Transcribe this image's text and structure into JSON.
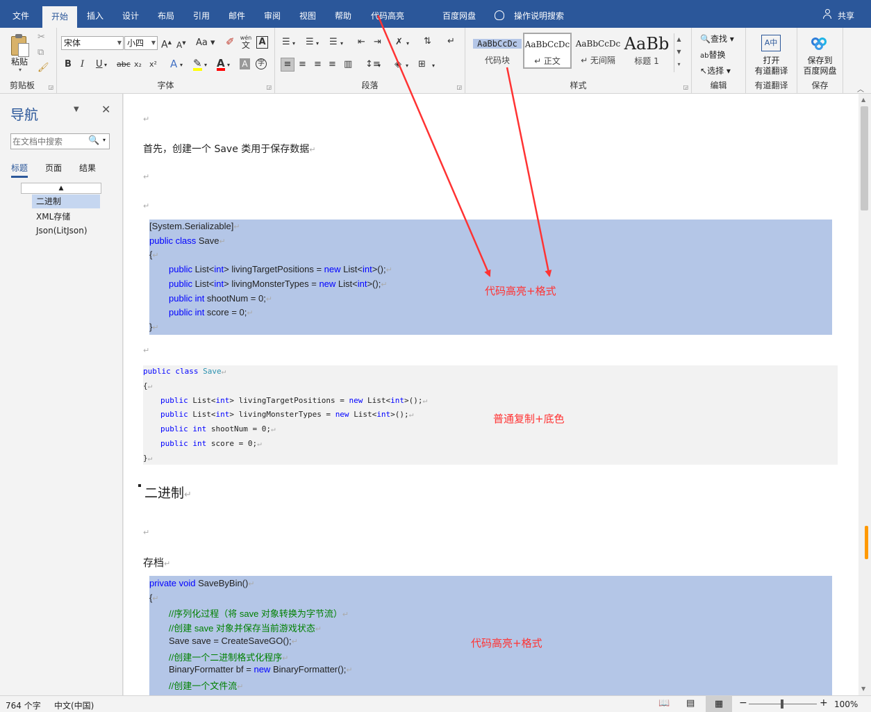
{
  "tabs": [
    "文件",
    "开始",
    "插入",
    "设计",
    "布局",
    "引用",
    "邮件",
    "审阅",
    "视图",
    "帮助",
    "代码高亮",
    "百度网盘"
  ],
  "tell_me": "操作说明搜索",
  "share": "共享",
  "ribbon": {
    "clipboard": {
      "paste": "粘贴",
      "label": "剪贴板"
    },
    "font": {
      "name": "宋体",
      "size": "小四",
      "label": "字体",
      "wen": "wén",
      "wen_char": "文",
      "grow": "A",
      "shrink": "A",
      "case": "Aa",
      "bold": "B",
      "italic": "I",
      "underline": "U",
      "strike": "abc",
      "sub": "x₂",
      "sup": "x²"
    },
    "paragraph": {
      "label": "段落"
    },
    "styles": {
      "label": "样式",
      "items": [
        {
          "sample": "AaBbCcDc",
          "name": "代码块"
        },
        {
          "sample": "AaBbCcDc",
          "name": "↵ 正文"
        },
        {
          "sample": "AaBbCcDc",
          "name": "↵ 无间隔"
        },
        {
          "sample": "AaBb",
          "name": "标题 1"
        }
      ]
    },
    "editing": {
      "find": "查找",
      "replace": "替换",
      "select": "选择",
      "label": "编辑"
    },
    "youdao": {
      "btn1": "打开",
      "btn2": "有道翻译",
      "label": "有道翻译"
    },
    "save": {
      "btn1": "保存到",
      "btn2": "百度网盘",
      "label": "保存"
    }
  },
  "nav": {
    "title": "导航",
    "search_placeholder": "在文档中搜索",
    "tabs": [
      "标题",
      "页面",
      "结果"
    ],
    "items": [
      "二进制",
      "XML存储",
      "Json(LitJson)"
    ]
  },
  "doc": {
    "p1": "首先，创建一个 Save 类用于保存数据",
    "heading": "二进制",
    "p2": "存档",
    "annot1": "代码高亮+格式",
    "annot2": "普通复制+底色",
    "annot3": "代码高亮+格式",
    "ret": "↵"
  },
  "code1": [
    {
      "indent": 0,
      "parts": [
        {
          "t": "[System.Serializable]",
          "c": ""
        }
      ]
    },
    {
      "indent": 0,
      "parts": [
        {
          "t": "public class ",
          "c": "kw"
        },
        {
          "t": "Save",
          "c": ""
        }
      ]
    },
    {
      "indent": 0,
      "parts": [
        {
          "t": "{",
          "c": ""
        }
      ]
    },
    {
      "indent": 1,
      "parts": [
        {
          "t": "public ",
          "c": "kw"
        },
        {
          "t": "List<",
          "c": ""
        },
        {
          "t": "int",
          "c": "kw"
        },
        {
          "t": "> livingTargetPositions = ",
          "c": ""
        },
        {
          "t": "new ",
          "c": "kw"
        },
        {
          "t": "List<",
          "c": ""
        },
        {
          "t": "int",
          "c": "kw"
        },
        {
          "t": ">();",
          "c": ""
        }
      ]
    },
    {
      "indent": 1,
      "parts": [
        {
          "t": "public ",
          "c": "kw"
        },
        {
          "t": "List<",
          "c": ""
        },
        {
          "t": "int",
          "c": "kw"
        },
        {
          "t": "> livingMonsterTypes = ",
          "c": ""
        },
        {
          "t": "new ",
          "c": "kw"
        },
        {
          "t": "List<",
          "c": ""
        },
        {
          "t": "int",
          "c": "kw"
        },
        {
          "t": ">();",
          "c": ""
        }
      ]
    },
    {
      "indent": 1,
      "parts": [
        {
          "t": "public int ",
          "c": "kw"
        },
        {
          "t": "shootNum = 0;",
          "c": ""
        }
      ]
    },
    {
      "indent": 1,
      "parts": [
        {
          "t": "public int ",
          "c": "kw"
        },
        {
          "t": "score = 0;",
          "c": ""
        }
      ]
    },
    {
      "indent": 0,
      "parts": [
        {
          "t": "}",
          "c": ""
        }
      ]
    }
  ],
  "code2": [
    {
      "indent": 0,
      "parts": [
        {
          "t": "public class ",
          "c": "pk"
        },
        {
          "t": "Save",
          "c": "ptype"
        }
      ]
    },
    {
      "indent": 0,
      "parts": [
        {
          "t": "{",
          "c": ""
        }
      ]
    },
    {
      "indent": 1,
      "parts": [
        {
          "t": "public ",
          "c": "pk"
        },
        {
          "t": "List<",
          "c": ""
        },
        {
          "t": "int",
          "c": "pk"
        },
        {
          "t": "> livingTargetPositions = ",
          "c": ""
        },
        {
          "t": "new ",
          "c": "pk"
        },
        {
          "t": "List<",
          "c": ""
        },
        {
          "t": "int",
          "c": "pk"
        },
        {
          "t": ">();",
          "c": ""
        }
      ]
    },
    {
      "indent": 1,
      "parts": [
        {
          "t": "public ",
          "c": "pk"
        },
        {
          "t": "List<",
          "c": ""
        },
        {
          "t": "int",
          "c": "pk"
        },
        {
          "t": "> livingMonsterTypes = ",
          "c": ""
        },
        {
          "t": "new ",
          "c": "pk"
        },
        {
          "t": "List<",
          "c": ""
        },
        {
          "t": "int",
          "c": "pk"
        },
        {
          "t": ">();",
          "c": ""
        }
      ]
    },
    {
      "indent": 1,
      "parts": [
        {
          "t": "public ",
          "c": "pk"
        },
        {
          "t": "int ",
          "c": "pk"
        },
        {
          "t": "shootNum = 0;",
          "c": ""
        }
      ]
    },
    {
      "indent": 1,
      "parts": [
        {
          "t": "public ",
          "c": "pk"
        },
        {
          "t": "int ",
          "c": "pk"
        },
        {
          "t": "score = 0;",
          "c": ""
        }
      ]
    },
    {
      "indent": 0,
      "parts": [
        {
          "t": "}",
          "c": ""
        }
      ]
    }
  ],
  "code3": [
    {
      "indent": 0,
      "parts": [
        {
          "t": "private void ",
          "c": "kw"
        },
        {
          "t": "SaveByBin()",
          "c": ""
        }
      ]
    },
    {
      "indent": 0,
      "parts": [
        {
          "t": "{",
          "c": ""
        }
      ]
    },
    {
      "indent": 1,
      "parts": [
        {
          "t": "//序列化过程（将 save 对象转换为字节流）",
          "c": "cm"
        }
      ]
    },
    {
      "indent": 1,
      "parts": [
        {
          "t": "//创建 save 对象并保存当前游戏状态",
          "c": "cm"
        }
      ]
    },
    {
      "indent": 1,
      "parts": [
        {
          "t": "Save save = CreateSaveGO();",
          "c": ""
        }
      ]
    },
    {
      "indent": 1,
      "parts": [
        {
          "t": "//创建一个二进制格式化程序",
          "c": "cm"
        }
      ]
    },
    {
      "indent": 1,
      "parts": [
        {
          "t": "BinaryFormatter bf = ",
          "c": ""
        },
        {
          "t": "new ",
          "c": "kw"
        },
        {
          "t": "BinaryFormatter();",
          "c": ""
        }
      ]
    },
    {
      "indent": 1,
      "parts": [
        {
          "t": "//创建一个文件流",
          "c": "cm"
        }
      ]
    }
  ],
  "status": {
    "words": "764 个字",
    "lang": "中文(中国)",
    "zoom": "100%"
  },
  "colors": {
    "title_bar": "#2b579a",
    "code_hl": "#b4c6e7",
    "annot": "#ff3333"
  }
}
